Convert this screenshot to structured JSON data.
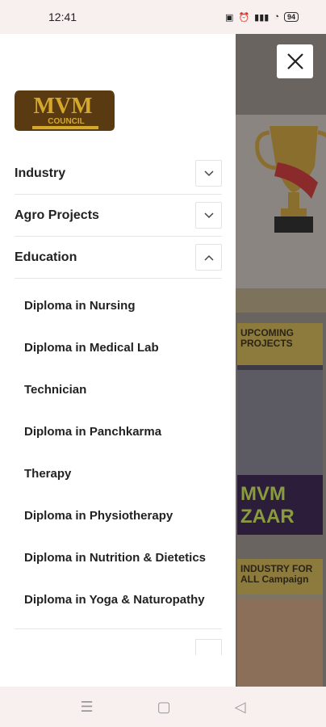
{
  "status_bar": {
    "time": "12:41",
    "battery": "94"
  },
  "drawer": {
    "logo": {
      "title": "MVM",
      "subtitle": "COUNCIL"
    },
    "menu": [
      {
        "label": "Industry",
        "expanded": false
      },
      {
        "label": "Agro Projects",
        "expanded": false
      },
      {
        "label": "Education",
        "expanded": true
      }
    ],
    "education_items": [
      "Diploma in Nursing",
      "Diploma in Medical Lab",
      "Technician",
      "Diploma in Panchkarma",
      "Therapy",
      "Diploma in Physiotherapy",
      "Diploma in Nutrition & Dietetics",
      "Diploma in Yoga & Naturopathy"
    ]
  },
  "background": {
    "promo1_title": "UPCOMING PROJECTS",
    "promo1_brand": "MVM ZAAR",
    "promo2_title": "INDUSTRY FOR ALL Campaign"
  },
  "colors": {
    "accent_gold": "#b8860b",
    "logo_brown": "#5a3a10"
  },
  "icons": {
    "close": "close-icon",
    "chevron_down": "chevron-down-icon",
    "chevron_up": "chevron-up-icon",
    "nav_menu": "menu-icon",
    "nav_home": "home-square-icon",
    "nav_back": "back-triangle-icon"
  }
}
